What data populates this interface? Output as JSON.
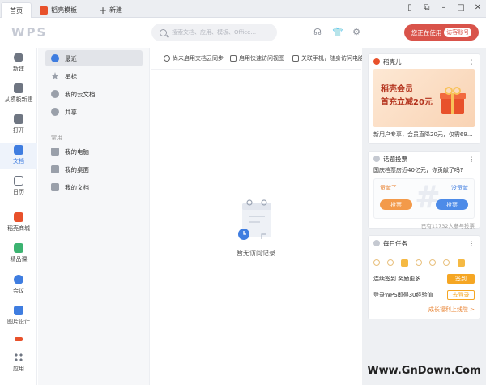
{
  "tabs": {
    "home": "首页",
    "template": "稻壳模板",
    "new": "新建"
  },
  "brand": {
    "logo": "WPS"
  },
  "search": {
    "placeholder": "搜索文档、应用、模板、Office..."
  },
  "account": {
    "label": "您正在使用",
    "guest": "访客账号"
  },
  "colors": {
    "accent": "#3f7de0",
    "account": "#d9534a",
    "orange": "#f5a623",
    "logo_tab": "#e8512b"
  },
  "leftbar": [
    {
      "label": "新建",
      "icon": "plus-circle-icon"
    },
    {
      "label": "从模板新建",
      "icon": "template-icon"
    },
    {
      "label": "打开",
      "icon": "folder-icon"
    },
    {
      "label": "文档",
      "icon": "document-icon"
    },
    {
      "label": "日历",
      "icon": "calendar-icon"
    },
    {
      "label": "稻壳商城",
      "icon": "store-icon"
    },
    {
      "label": "精品课",
      "icon": "course-icon"
    },
    {
      "label": "会议",
      "icon": "meeting-icon"
    },
    {
      "label": "图片设计",
      "icon": "image-design-icon"
    },
    {
      "label": "应用",
      "icon": "apps-icon"
    }
  ],
  "nav": {
    "items": [
      {
        "label": "最近"
      },
      {
        "label": "星标"
      },
      {
        "label": "我的云文档"
      },
      {
        "label": "共享"
      }
    ],
    "section": "常用",
    "common": [
      {
        "label": "我的电脑"
      },
      {
        "label": "我的桌面"
      },
      {
        "label": "我的文档"
      }
    ]
  },
  "quick_actions": [
    "尚未启用文档云同步",
    "启用快速访问视图",
    "关联手机，随身访问电脑"
  ],
  "empty": {
    "text": "暂无访问记录"
  },
  "promo": {
    "title": "稻壳儿",
    "line1": "稻壳会员",
    "line2": "首充立减20元",
    "caption": "新用户专享，会员直降20元，仅需69..."
  },
  "vote": {
    "title": "话题投票",
    "question": "国庆档票房近40亿元，你贡献了吗?",
    "left": "贡献了",
    "right": "没贡献",
    "button": "投票",
    "count": "已有11732人参与投票"
  },
  "tasks": {
    "title": "每日任务",
    "sign_text": "连续签到 奖励更多",
    "sign_btn": "签到",
    "login_text": "登录WPS即得30经验值",
    "login_btn": "去登录",
    "more": "成长福利上线啦 >"
  },
  "watermark": "Www.GnDown.Com"
}
